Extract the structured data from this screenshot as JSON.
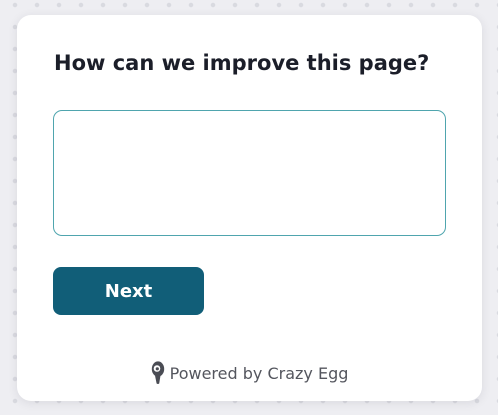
{
  "survey": {
    "question": "How can we improve this page?",
    "answer_value": "",
    "answer_placeholder": "",
    "next_label": "Next"
  },
  "footer": {
    "powered_by": "Powered by Crazy Egg",
    "icon": "crazy-egg-logo-icon"
  },
  "colors": {
    "button": "#115e78",
    "input_border": "#4fa5ae",
    "heading": "#1b1e29",
    "footer_text": "#54565e",
    "background": "#eeeef2"
  }
}
